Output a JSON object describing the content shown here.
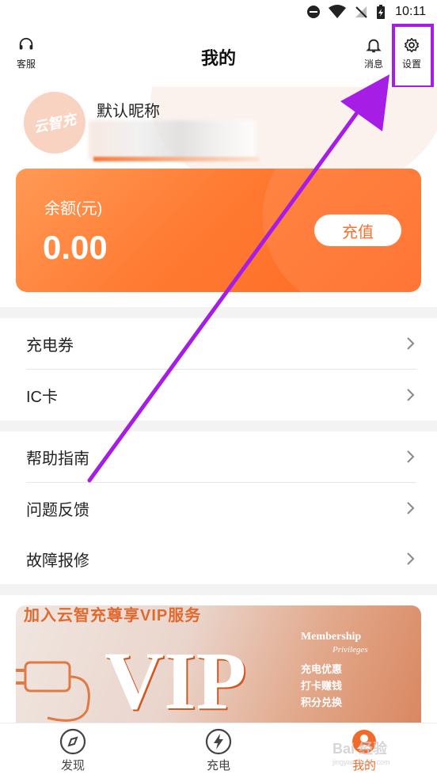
{
  "status_bar": {
    "time": "10:11"
  },
  "header": {
    "title": "我的",
    "customer_service_label": "客服",
    "messages_label": "消息",
    "settings_label": "设置"
  },
  "profile": {
    "nickname": "默认昵称",
    "avatar_logo_text": "云智充"
  },
  "balance": {
    "label": "余额(元)",
    "amount": "0.00",
    "recharge_label": "充值"
  },
  "menu_group_1": [
    {
      "label": "充电券"
    },
    {
      "label": "IC卡"
    }
  ],
  "menu_group_2": [
    {
      "label": "帮助指南"
    },
    {
      "label": "问题反馈"
    },
    {
      "label": "故障报修"
    }
  ],
  "vip_banner": {
    "top_text": "加入云智充尊享VIP服务",
    "big_text": "VIP",
    "membership": "Membership",
    "privileges": "Privileges",
    "benefits": [
      "充电优惠",
      "打卡赚钱",
      "积分兑换"
    ]
  },
  "tabbar": [
    {
      "label": "发现"
    },
    {
      "label": "充电"
    },
    {
      "label": "我的"
    }
  ],
  "watermark": {
    "text": "Bai 经验",
    "url": "jingyan.baidu.com"
  },
  "colors": {
    "accent": "#ff6e2b",
    "annotation": "#a61ee6"
  }
}
